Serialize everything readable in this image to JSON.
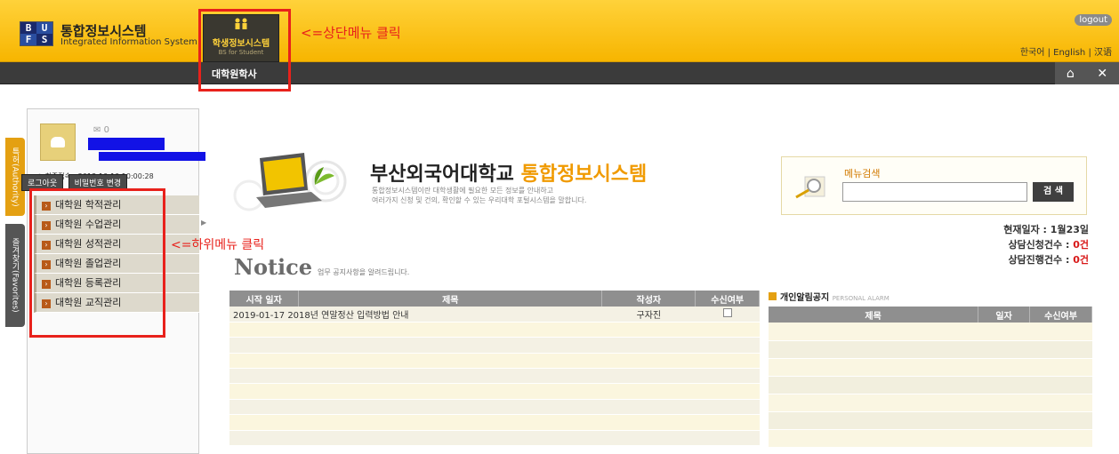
{
  "header": {
    "logo_letters": [
      "B",
      "U",
      "F",
      "S"
    ],
    "title": "통합정보시스템",
    "subtitle": "Integrated Information System",
    "top_menu": {
      "label": "학생정보시스템",
      "sub": "BS for Student"
    },
    "annotation": "<=상단메뉴 클릭",
    "logout": "logout",
    "languages": "한국어 | English | 汉语"
  },
  "nav": {
    "item": "대학원학사",
    "home_icon": "⌂",
    "close_icon": "✕"
  },
  "side_tabs": [
    "특허(Authority)",
    "즐겨찾기(Favorites)"
  ],
  "profile": {
    "mail_count": "0",
    "last_login": "최종접속 : 2018-10-10 10:00:28",
    "logout_btn": "로그아웃",
    "password_btn": "비밀번호 변경"
  },
  "left_menu": [
    "대학원 학적관리",
    "대학원 수업관리",
    "대학원 성적관리",
    "대학원 졸업관리",
    "대학원 등록관리",
    "대학원 교직관리"
  ],
  "left_annotation": "<=하위메뉴 클릭",
  "banner": {
    "title_main": "부산외국어대학교 ",
    "title_accent": "통합정보시스템",
    "desc_line1": "통합정보시스템이란 대학생활에 필요한 모든 정보를 안내하고",
    "desc_line2": "여러가지 신청 및 건의, 확인할 수 있는 우리대학 포털시스템을 말합니다."
  },
  "search": {
    "label": "메뉴검색",
    "value": "",
    "button": "검 색"
  },
  "stats": {
    "date_label": "현재일자 : ",
    "date_value": "1월23일",
    "apply_label": "상담신청건수 : ",
    "apply_value": "0건",
    "progress_label": "상담진행건수 : ",
    "progress_value": "0건"
  },
  "notice": {
    "title": "Notice",
    "desc": "업무 공지사항을 알려드립니다.",
    "columns": [
      "시작 일자",
      "제목",
      "작성자",
      "수신여부"
    ],
    "rows": [
      {
        "date": "2019-01-17",
        "title": "2018년 연말정산 입력방법 안내",
        "author": "구자진"
      }
    ]
  },
  "alarm": {
    "title": "개인알림공지",
    "title_en": "PERSONAL ALARM",
    "columns": [
      "제목",
      "일자",
      "수신여부"
    ]
  },
  "colors": {
    "header_yellow": "#f7b500",
    "accent_orange": "#f09a00",
    "annotation_red": "#e8211b",
    "nav_dark": "#3b3b3b"
  }
}
